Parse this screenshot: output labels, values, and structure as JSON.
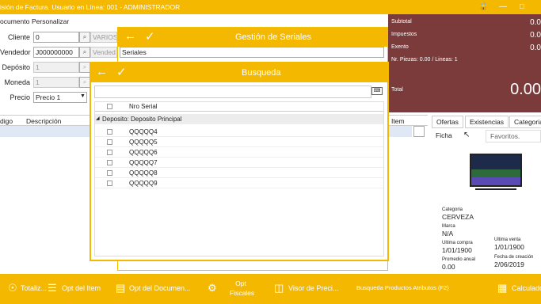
{
  "titlebar": {
    "title": "isión de Factura. Usuario en Línea: 001 - ADMINISTRADOR"
  },
  "menu": {
    "items": [
      "ocumento",
      "Personalizar"
    ]
  },
  "form": {
    "cliente_label": "Cliente",
    "cliente_value": "0",
    "cliente_name": "VARIOS",
    "vendedor_label": "Vendedor",
    "vendedor_value": "J000000000",
    "vendedor_name": "Vended",
    "deposito_label": "Depósito",
    "deposito_value": "1",
    "moneda_label": "Moneda",
    "moneda_value": "1",
    "precio_label": "Precio",
    "precio_value": "Precio 1"
  },
  "grid": {
    "headers": [
      "digo",
      "Descripción",
      "Item"
    ]
  },
  "summary": {
    "subtotal_label": "Subtotal",
    "subtotal_value": "0.0",
    "impuestos_label": "Impuestos",
    "impuestos_value": "0.0",
    "exento_label": "Exento",
    "exento_value": "0.0",
    "piezas": "Nr. Piezas: 0.00 / Lineas: 1",
    "total_label": "Total",
    "total_value": "0.00"
  },
  "rpanel": {
    "tabs": [
      "Ofertas",
      "Existencias",
      "Categoria"
    ],
    "subtabs": [
      "Ficha",
      "Favoritos."
    ],
    "categoria_label": "Categoria",
    "categoria_value": "CERVEZA",
    "marca_label": "Marca",
    "marca_value": "N/A",
    "ultima_compra_label": "Ultima compra",
    "ultima_compra_value": "1/01/1900",
    "ultima_venta_label": "Ultima venta",
    "ultima_venta_value": "1/01/1900",
    "promedio_label": "Promedio anual",
    "promedio_value": "0.00",
    "fecha_label": "Fecha de creación",
    "fecha_value": "2/06/2019"
  },
  "dlg1": {
    "title": "Gestión de Seriales",
    "field": "Seriales"
  },
  "dlg2": {
    "title": "Busqueda",
    "col_header": "Nro Serial",
    "group": "Deposito: Deposito Principal",
    "rows": [
      "QQQQQ4",
      "QQQQQ5",
      "QQQQQ6",
      "QQQQQ7",
      "QQQQQ8",
      "QQQQQ9"
    ]
  },
  "bottom": {
    "items": [
      "Totaliz...",
      "Opt del Item",
      "Opt del Documen...",
      "Opt\nFiscales",
      "Visor de Preci...",
      "Busqueda Productos Atributos (F2)",
      "Calculado"
    ]
  }
}
